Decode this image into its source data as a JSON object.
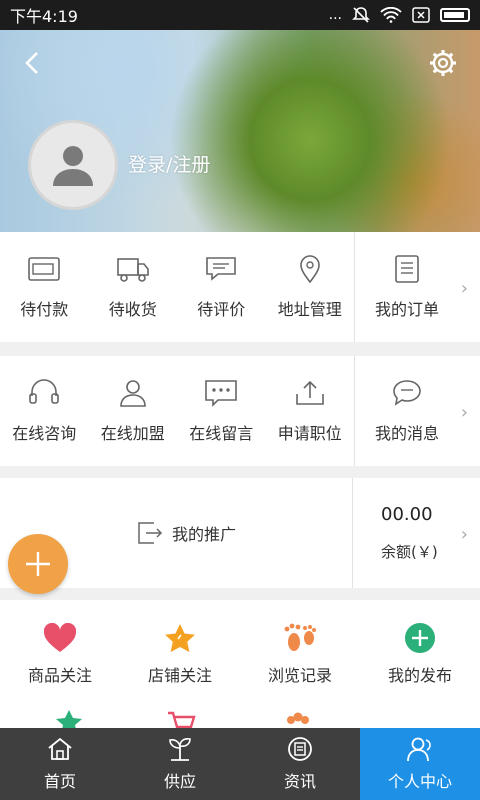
{
  "status": {
    "time": "下午4:19",
    "dots": "..."
  },
  "header": {
    "login_label": "登录/注册"
  },
  "orders": {
    "items": [
      {
        "label": "待付款",
        "icon": "wallet-icon"
      },
      {
        "label": "待收货",
        "icon": "truck-icon"
      },
      {
        "label": "待评价",
        "icon": "comment-icon"
      },
      {
        "label": "地址管理",
        "icon": "location-pin-icon"
      }
    ],
    "side": {
      "label": "我的订单",
      "icon": "order-list-icon"
    }
  },
  "services": {
    "items": [
      {
        "label": "在线咨询",
        "icon": "headset-icon"
      },
      {
        "label": "在线加盟",
        "icon": "person-icon"
      },
      {
        "label": "在线留言",
        "icon": "message-dots-icon"
      },
      {
        "label": "申请职位",
        "icon": "upload-icon"
      }
    ],
    "side": {
      "label": "我的消息",
      "icon": "chat-bubble-icon"
    }
  },
  "promo": {
    "label": "我的推广",
    "icon": "share-arrow-icon"
  },
  "balance": {
    "amount": "00.00",
    "label": "余额(￥)"
  },
  "favorites": [
    {
      "label": "商品关注",
      "icon": "heart-icon",
      "color": "#e8506a"
    },
    {
      "label": "店铺关注",
      "icon": "star-icon",
      "color": "#f4a020"
    },
    {
      "label": "浏览记录",
      "icon": "footprint-icon",
      "color": "#f08a4a"
    },
    {
      "label": "我的发布",
      "icon": "plus-circle-icon",
      "color": "#2bb07a"
    }
  ],
  "tabs": [
    {
      "label": "首页",
      "icon": "home-icon",
      "active": false
    },
    {
      "label": "供应",
      "icon": "plant-icon",
      "active": false
    },
    {
      "label": "资讯",
      "icon": "news-icon",
      "active": false
    },
    {
      "label": "个人中心",
      "icon": "user-icon",
      "active": true
    }
  ],
  "colors": {
    "accent": "#1e90e6",
    "fab": "#f1a146",
    "tabbar": "#3f3f3f"
  }
}
